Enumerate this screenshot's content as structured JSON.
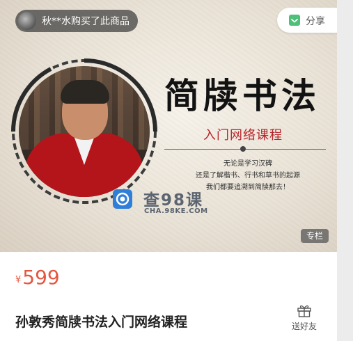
{
  "banner": {
    "buyer_notice": "秋**水购买了此商品",
    "share_label": "分享",
    "title": "简牍书法",
    "subtitle": "入门网络课程",
    "description_lines": [
      "无论是学习汉碑",
      "还是了解楷书、行书和草书的起源",
      "我们都要追溯到简牍那去！"
    ],
    "watermark_text": "查98课",
    "watermark_url": "CHA.98KE.COM",
    "badge": "专栏"
  },
  "product": {
    "currency": "¥",
    "price": "599",
    "title": "孙敦秀简牍书法入门网络课程",
    "gift_label": "送好友"
  },
  "colors": {
    "price": "#e6553f",
    "subtitle": "#b8242a",
    "share_icon": "#4fc07a"
  },
  "icons": [
    "user-avatar-icon",
    "share-icon",
    "watermark-logo-icon",
    "gift-icon"
  ]
}
